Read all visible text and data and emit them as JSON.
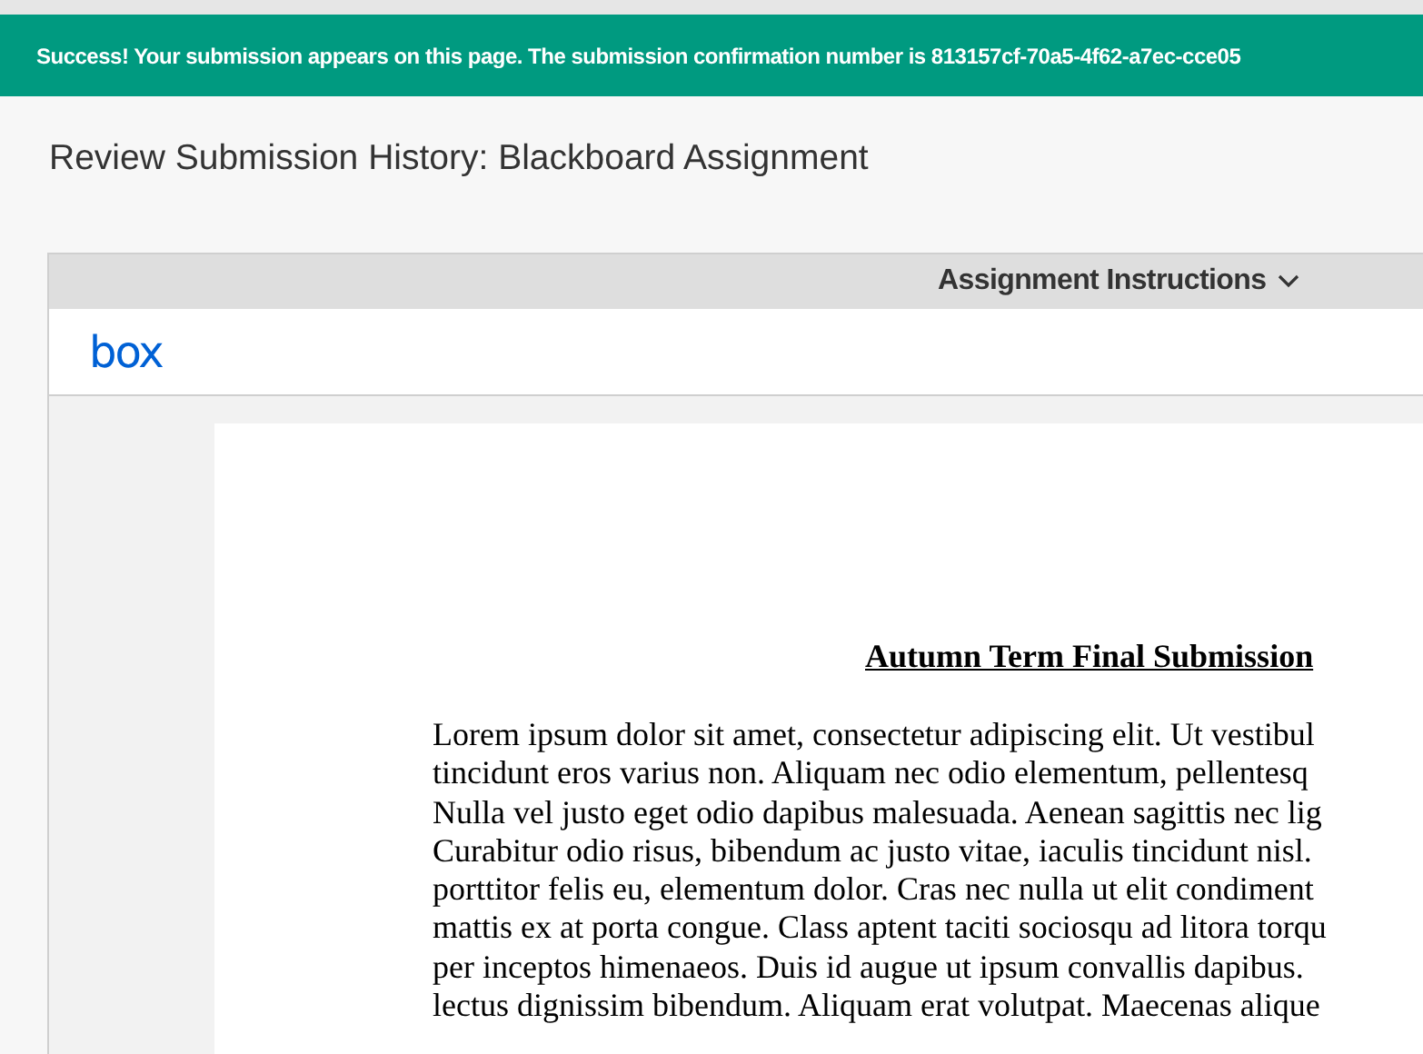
{
  "banner": {
    "message": "Success! Your submission appears on this page. The submission confirmation number is 813157cf-70a5-4f62-a7ec-cce05"
  },
  "page_title": "Review Submission History: Blackboard Assignment",
  "viewer": {
    "instructions_toggle": {
      "label": "Assignment Instructions",
      "expanded": false
    },
    "logo": "box",
    "document": {
      "heading": "Autumn Term Final Submission",
      "lines": [
        "Lorem ipsum dolor sit amet, consectetur adipiscing elit. Ut vestibul",
        "tincidunt eros varius non. Aliquam nec odio elementum, pellentesq",
        "Nulla vel justo eget odio dapibus malesuada. Aenean sagittis nec lig",
        "Curabitur odio risus, bibendum ac justo vitae, iaculis tincidunt nisl.",
        "porttitor felis eu, elementum dolor. Cras nec nulla ut elit condiment",
        "mattis ex at porta congue. Class aptent taciti sociosqu ad litora torqu",
        "per inceptos himenaeos. Duis id augue ut ipsum convallis dapibus.",
        "lectus dignissim bibendum. Aliquam erat volutpat. Maecenas alique"
      ]
    }
  }
}
